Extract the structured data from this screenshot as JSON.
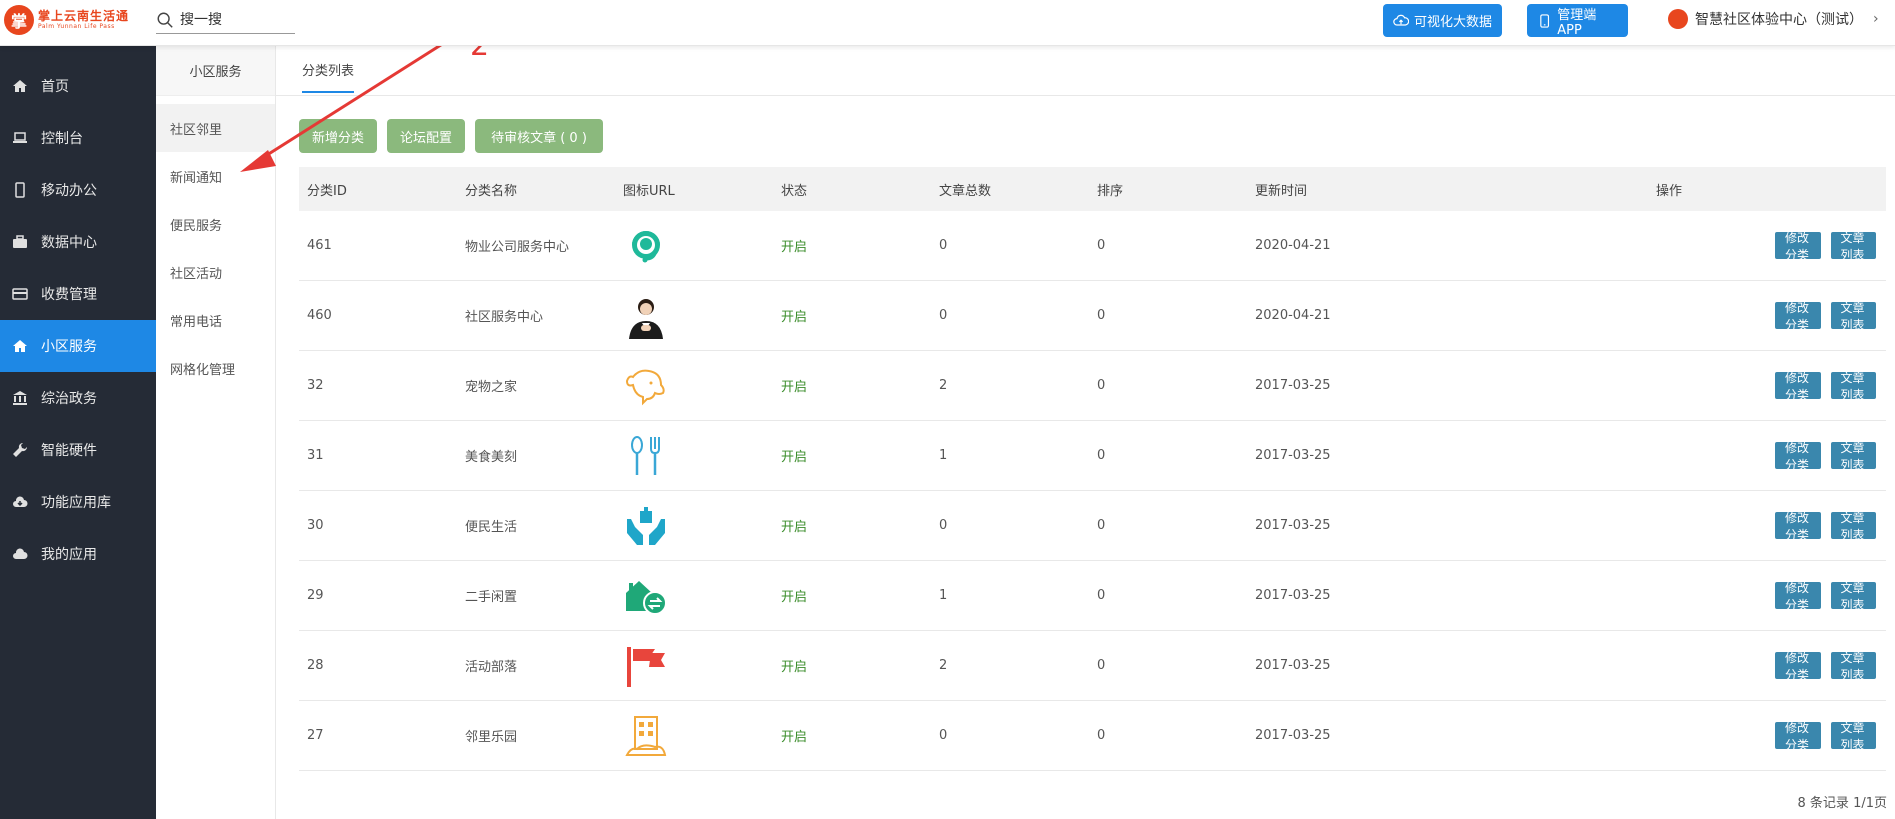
{
  "header": {
    "logo_mark": "掌",
    "logo_name": "掌上云南生活通",
    "logo_en": "Palm Yunnan Life Pass",
    "search_placeholder": "搜一搜",
    "bigdata_label": "可视化大数据",
    "app_label": "管理端APP",
    "user_name": "智慧社区体验中心（测试）",
    "chevron": "›"
  },
  "sidebar": {
    "items": [
      {
        "label": "首页",
        "icon": "home-icon"
      },
      {
        "label": "控制台",
        "icon": "laptop-icon"
      },
      {
        "label": "移动办公",
        "icon": "mobile-icon"
      },
      {
        "label": "数据中心",
        "icon": "briefcase-icon"
      },
      {
        "label": "收费管理",
        "icon": "card-icon"
      },
      {
        "label": "小区服务",
        "icon": "home-icon",
        "active": true
      },
      {
        "label": "综治政务",
        "icon": "bank-icon"
      },
      {
        "label": "智能硬件",
        "icon": "wrench-icon"
      },
      {
        "label": "功能应用库",
        "icon": "cloud-download-icon"
      },
      {
        "label": "我的应用",
        "icon": "cloud-icon"
      }
    ]
  },
  "submenu": {
    "title": "小区服务",
    "items": [
      "社区邻里",
      "新闻通知",
      "便民服务",
      "社区活动",
      "常用电话",
      "网格化管理"
    ]
  },
  "tabs": {
    "active": "分类列表"
  },
  "actions": {
    "add": "新增分类",
    "forum": "论坛配置",
    "pending": "待审核文章 ( 0 )"
  },
  "table": {
    "headers": [
      "分类ID",
      "分类名称",
      "图标URL",
      "状态",
      "文章总数",
      "排序",
      "更新时间",
      "操作"
    ],
    "edit_label": "修改分类",
    "list_label": "文章列表",
    "rows": [
      {
        "id": "461",
        "name": "物业公司服务中心",
        "icon": "headset-icon",
        "status": "开启",
        "count": "0",
        "sort": "0",
        "time": "2020-04-21"
      },
      {
        "id": "460",
        "name": "社区服务中心",
        "icon": "staff-photo-icon",
        "status": "开启",
        "count": "0",
        "sort": "0",
        "time": "2020-04-21"
      },
      {
        "id": "32",
        "name": "宠物之家",
        "icon": "dog-icon",
        "status": "开启",
        "count": "2",
        "sort": "0",
        "time": "2017-03-25"
      },
      {
        "id": "31",
        "name": "美食美刻",
        "icon": "spoon-fork-icon",
        "status": "开启",
        "count": "1",
        "sort": "0",
        "time": "2017-03-25"
      },
      {
        "id": "30",
        "name": "便民生活",
        "icon": "hands-gift-icon",
        "status": "开启",
        "count": "0",
        "sort": "0",
        "time": "2017-03-25"
      },
      {
        "id": "29",
        "name": "二手闲置",
        "icon": "house-exchange-icon",
        "status": "开启",
        "count": "1",
        "sort": "0",
        "time": "2017-03-25"
      },
      {
        "id": "28",
        "name": "活动部落",
        "icon": "flag-icon",
        "status": "开启",
        "count": "2",
        "sort": "0",
        "time": "2017-03-25"
      },
      {
        "id": "27",
        "name": "邻里乐园",
        "icon": "building-icon",
        "status": "开启",
        "count": "0",
        "sort": "0",
        "time": "2017-03-25"
      }
    ]
  },
  "pager": {
    "text": "8 条记录 1/1页"
  },
  "annotation": {
    "number": "2"
  },
  "colors": {
    "primary": "#1e88e5",
    "sidebar_bg": "#252b36",
    "action_green": "#8bb97d",
    "op_blue": "#3a87ad",
    "status_green": "#3a8c2a",
    "annot_red": "#e53935"
  }
}
